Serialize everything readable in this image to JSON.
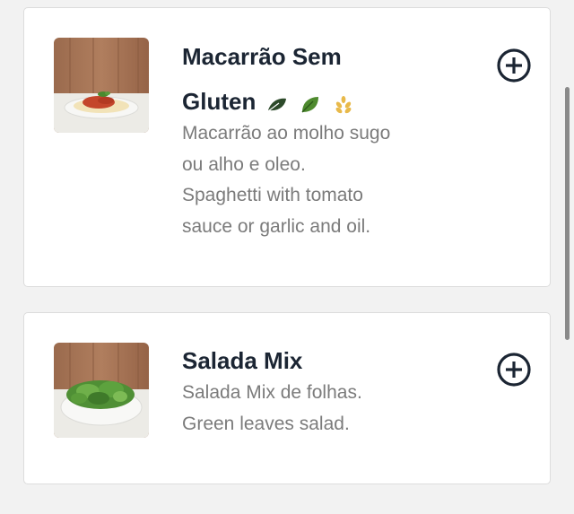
{
  "menu_items": [
    {
      "title_line1": "Macarrão Sem",
      "title_line2": "Gluten",
      "diet_icons": [
        "leaf-dark-icon",
        "leaf-green-icon",
        "wheat-icon"
      ],
      "description_lines": [
        "Macarrão ao molho sugo",
        "ou alho e oleo.",
        "Spaghetti with tomato",
        "sauce or garlic and oil."
      ],
      "add_icon": "plus-circle-icon",
      "image_icon": "pasta-photo"
    },
    {
      "title": "Salada Mix",
      "description_lines": [
        "Salada Mix de folhas.",
        "Green leaves salad."
      ],
      "add_icon": "plus-circle-icon",
      "image_icon": "salad-photo"
    }
  ],
  "colors": {
    "background": "#f2f2f2",
    "card": "#ffffff",
    "title": "#1b2533",
    "description": "#7b7b7b",
    "accent": "#1b2533"
  }
}
